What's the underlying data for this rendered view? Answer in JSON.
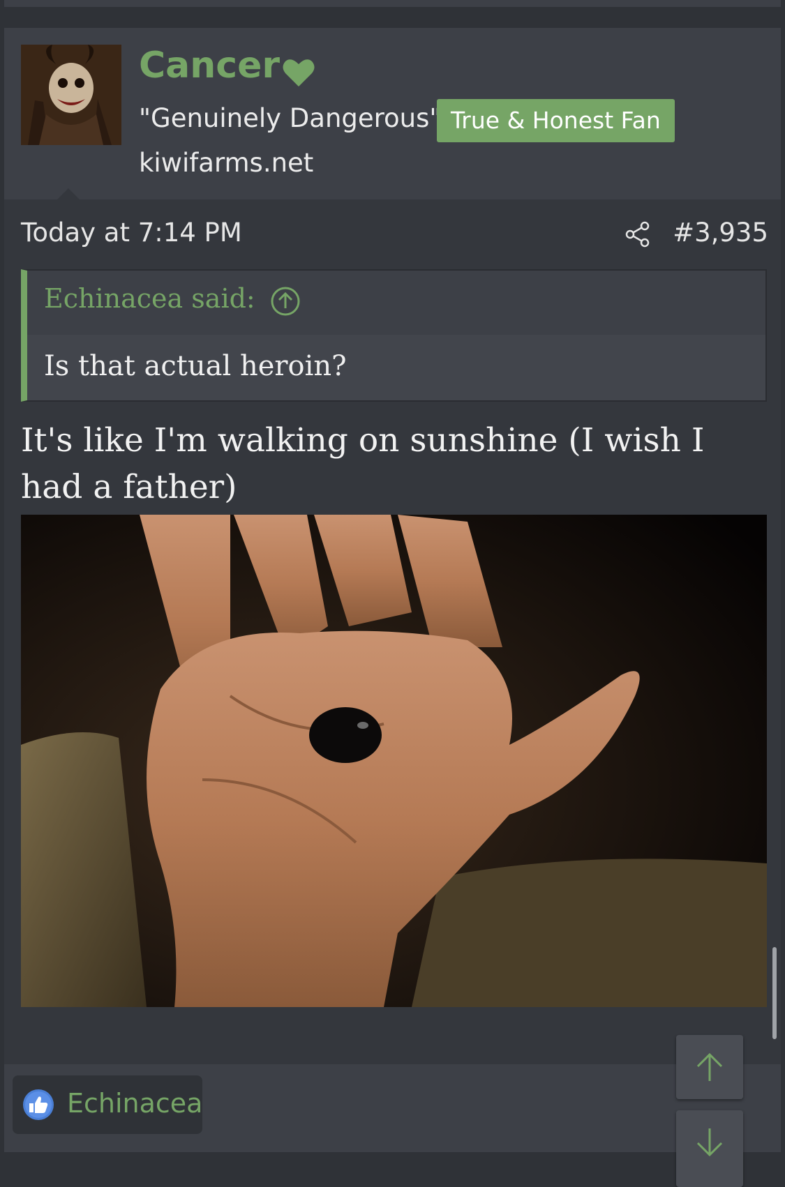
{
  "post": {
    "username": "Cancer",
    "user_title": "\"Genuinely Dangerous\"",
    "banner": "True & Honest Fan",
    "user_site": "kiwifarms.net",
    "date": "Today at 7:14 PM",
    "number": "#3,935",
    "quote": {
      "author_line": "Echinacea said:",
      "text": "Is that actual heroin?"
    },
    "message": "It's like I'm walking on sunshine (I wish I had a father)"
  },
  "reactions": {
    "name": "Echinacea",
    "icon": "like-icon"
  },
  "colors": {
    "accent": "#76a566",
    "background": "#2f3237",
    "panel": "#3d4047"
  },
  "icons": [
    "heart-icon",
    "share-icon",
    "arrow-up-circle-icon",
    "like-icon",
    "arrow-up-icon",
    "arrow-down-icon"
  ]
}
